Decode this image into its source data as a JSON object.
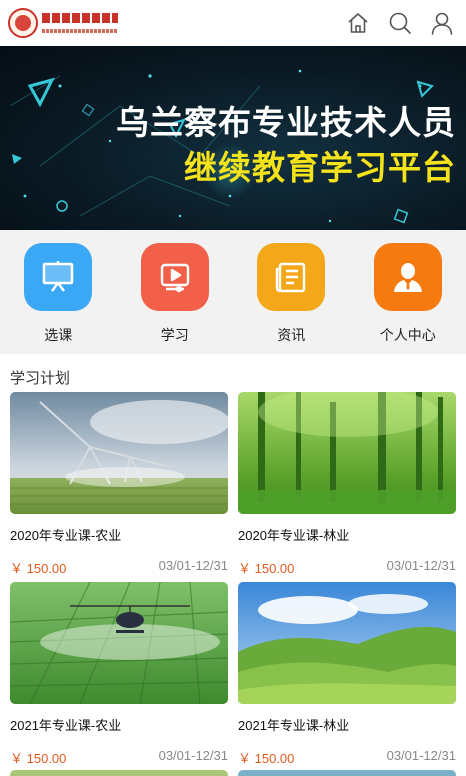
{
  "header": {
    "logo_alt": "中国乌兰察布专业技术人员继续教育",
    "icons": [
      "home-icon",
      "search-icon",
      "user-icon"
    ]
  },
  "banner": {
    "line1": "乌兰察布专业技术人员",
    "line2": "继续教育学习平台",
    "colors": {
      "line1": "#ffffff",
      "line2": "#f4e21a",
      "background": "#0a1a24"
    }
  },
  "nav": {
    "items": [
      {
        "label": "选课",
        "icon": "presentation-board-icon",
        "color": "#3aa8f5"
      },
      {
        "label": "学习",
        "icon": "video-play-icon",
        "color": "#f2604a"
      },
      {
        "label": "资讯",
        "icon": "news-document-icon",
        "color": "#f5a71a"
      },
      {
        "label": "个人中心",
        "icon": "person-icon",
        "color": "#f57a10"
      }
    ]
  },
  "plan": {
    "title": "学习计划",
    "courses": [
      {
        "name": "2020年专业课-农业",
        "price": "￥ 150.00",
        "date": "03/01-12/31",
        "image": "irrigation-field"
      },
      {
        "name": "2020年专业课-林业",
        "price": "￥ 150.00",
        "date": "03/01-12/31",
        "image": "green-forest"
      },
      {
        "name": "2021年专业课-农业",
        "price": "￥ 150.00",
        "date": "03/01-12/31",
        "image": "crop-spraying-helicopter"
      },
      {
        "name": "2021年专业课-林业",
        "price": "￥ 150.00",
        "date": "03/01-12/31",
        "image": "green-hills"
      }
    ]
  }
}
